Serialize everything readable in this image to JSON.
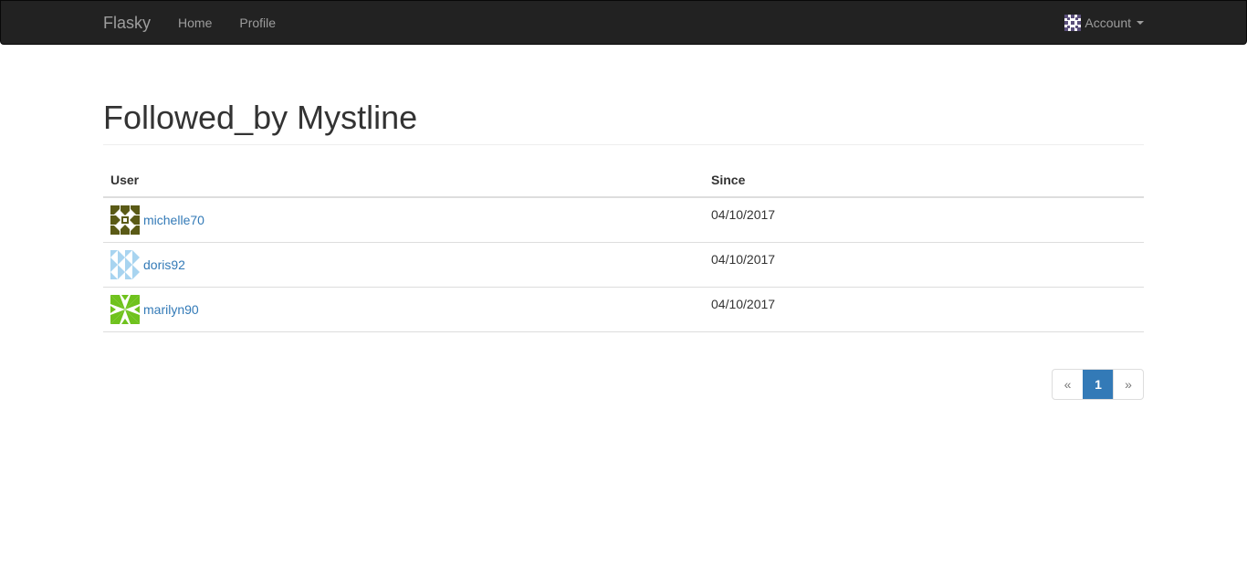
{
  "navbar": {
    "brand": "Flasky",
    "links": [
      "Home",
      "Profile"
    ],
    "account_label": "Account"
  },
  "page": {
    "title": "Followed_by Mystline"
  },
  "table": {
    "headers": [
      "User",
      "Since"
    ],
    "rows": [
      {
        "user": "michelle70",
        "since": "04/10/2017",
        "avatar_color": "#5a5a16"
      },
      {
        "user": "doris92",
        "since": "04/10/2017",
        "avatar_color": "#a8d4f0"
      },
      {
        "user": "marilyn90",
        "since": "04/10/2017",
        "avatar_color": "#6fc21d"
      }
    ]
  },
  "pagination": {
    "prev": "«",
    "current": "1",
    "next": "»"
  },
  "colors": {
    "navbar_bg": "#222222",
    "link": "#337ab7",
    "active_page": "#337ab7"
  }
}
